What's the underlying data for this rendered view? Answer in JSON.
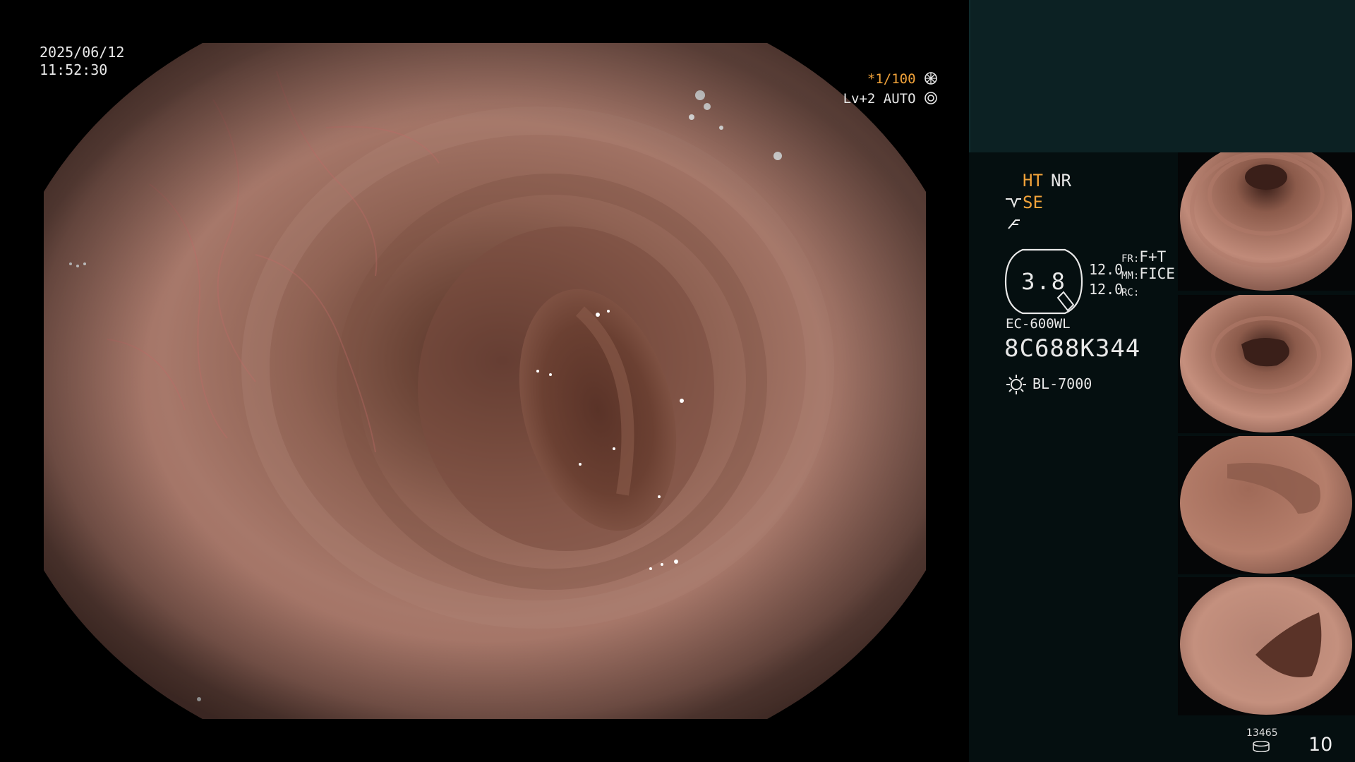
{
  "overlay": {
    "date": "2025/06/12",
    "time": "11:52:30",
    "shutter": "*1/100",
    "level": "Lv+2",
    "mode": "AUTO"
  },
  "panel": {
    "ht": "HT",
    "nr": "NR",
    "se": "SE",
    "star": "*",
    "zoom": "3.8",
    "value_1": "12.0",
    "value_2": "12.0",
    "fr_label": "FR:",
    "fr_value": "F+T",
    "mm_label": "MM:",
    "mm_value": "FICE",
    "rc_label": "RC:",
    "model": "EC-600WL",
    "serial": "8C688K344",
    "light_source": "BL-7000",
    "counter": "13465",
    "page": "10"
  },
  "colors": {
    "accent": "#f2a33a",
    "panel_top": "#0c2123",
    "panel_bg": "#050f10",
    "tissue": "#9c6c5e"
  },
  "icons": [
    "shutter-icon",
    "auto-icon",
    "se-icon",
    "f-icon",
    "doc-icon",
    "light-icon",
    "drive-icon"
  ]
}
